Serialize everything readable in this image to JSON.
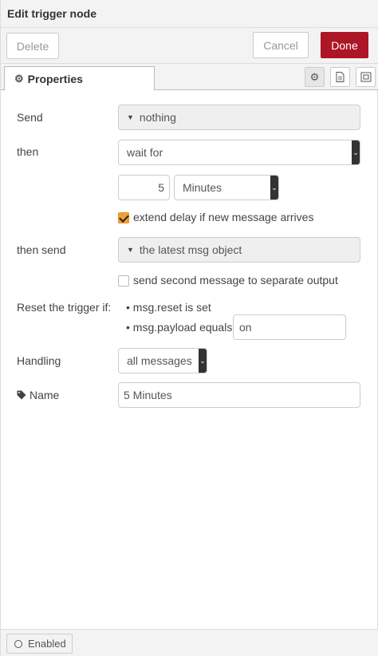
{
  "header": {
    "title": "Edit trigger node"
  },
  "toolbar": {
    "delete_label": "Delete",
    "cancel_label": "Cancel",
    "done_label": "Done"
  },
  "tabs": {
    "properties_label": "Properties"
  },
  "form": {
    "send": {
      "label": "Send",
      "value": "nothing"
    },
    "then": {
      "label": "then",
      "value": "wait for"
    },
    "delay": {
      "amount": "5",
      "unit": "Minutes"
    },
    "extend_delay": {
      "label": "extend delay if new message arrives",
      "checked": true
    },
    "then_send": {
      "label": "then send",
      "value": "the latest msg object"
    },
    "second_output": {
      "label": "send second message to separate output",
      "checked": false
    },
    "reset": {
      "label": "Reset the trigger if:",
      "item1": "msg.reset is set",
      "item2": "msg.payload equals",
      "payload_value": "on"
    },
    "handling": {
      "label": "Handling",
      "value": "all messages"
    },
    "name": {
      "label": "Name",
      "value": "5 Minutes"
    }
  },
  "footer": {
    "enabled_label": "Enabled"
  },
  "colors": {
    "done_button": "#ad1625",
    "checkbox_checked": "#f0a030"
  }
}
